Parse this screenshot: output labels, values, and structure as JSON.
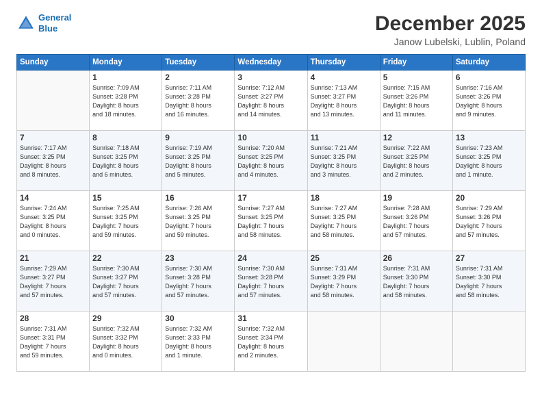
{
  "header": {
    "logo_line1": "General",
    "logo_line2": "Blue",
    "month": "December 2025",
    "location": "Janow Lubelski, Lublin, Poland"
  },
  "weekdays": [
    "Sunday",
    "Monday",
    "Tuesday",
    "Wednesday",
    "Thursday",
    "Friday",
    "Saturday"
  ],
  "weeks": [
    [
      {
        "day": "",
        "info": ""
      },
      {
        "day": "1",
        "info": "Sunrise: 7:09 AM\nSunset: 3:28 PM\nDaylight: 8 hours\nand 18 minutes."
      },
      {
        "day": "2",
        "info": "Sunrise: 7:11 AM\nSunset: 3:28 PM\nDaylight: 8 hours\nand 16 minutes."
      },
      {
        "day": "3",
        "info": "Sunrise: 7:12 AM\nSunset: 3:27 PM\nDaylight: 8 hours\nand 14 minutes."
      },
      {
        "day": "4",
        "info": "Sunrise: 7:13 AM\nSunset: 3:27 PM\nDaylight: 8 hours\nand 13 minutes."
      },
      {
        "day": "5",
        "info": "Sunrise: 7:15 AM\nSunset: 3:26 PM\nDaylight: 8 hours\nand 11 minutes."
      },
      {
        "day": "6",
        "info": "Sunrise: 7:16 AM\nSunset: 3:26 PM\nDaylight: 8 hours\nand 9 minutes."
      }
    ],
    [
      {
        "day": "7",
        "info": "Sunrise: 7:17 AM\nSunset: 3:25 PM\nDaylight: 8 hours\nand 8 minutes."
      },
      {
        "day": "8",
        "info": "Sunrise: 7:18 AM\nSunset: 3:25 PM\nDaylight: 8 hours\nand 6 minutes."
      },
      {
        "day": "9",
        "info": "Sunrise: 7:19 AM\nSunset: 3:25 PM\nDaylight: 8 hours\nand 5 minutes."
      },
      {
        "day": "10",
        "info": "Sunrise: 7:20 AM\nSunset: 3:25 PM\nDaylight: 8 hours\nand 4 minutes."
      },
      {
        "day": "11",
        "info": "Sunrise: 7:21 AM\nSunset: 3:25 PM\nDaylight: 8 hours\nand 3 minutes."
      },
      {
        "day": "12",
        "info": "Sunrise: 7:22 AM\nSunset: 3:25 PM\nDaylight: 8 hours\nand 2 minutes."
      },
      {
        "day": "13",
        "info": "Sunrise: 7:23 AM\nSunset: 3:25 PM\nDaylight: 8 hours\nand 1 minute."
      }
    ],
    [
      {
        "day": "14",
        "info": "Sunrise: 7:24 AM\nSunset: 3:25 PM\nDaylight: 8 hours\nand 0 minutes."
      },
      {
        "day": "15",
        "info": "Sunrise: 7:25 AM\nSunset: 3:25 PM\nDaylight: 7 hours\nand 59 minutes."
      },
      {
        "day": "16",
        "info": "Sunrise: 7:26 AM\nSunset: 3:25 PM\nDaylight: 7 hours\nand 59 minutes."
      },
      {
        "day": "17",
        "info": "Sunrise: 7:27 AM\nSunset: 3:25 PM\nDaylight: 7 hours\nand 58 minutes."
      },
      {
        "day": "18",
        "info": "Sunrise: 7:27 AM\nSunset: 3:25 PM\nDaylight: 7 hours\nand 58 minutes."
      },
      {
        "day": "19",
        "info": "Sunrise: 7:28 AM\nSunset: 3:26 PM\nDaylight: 7 hours\nand 57 minutes."
      },
      {
        "day": "20",
        "info": "Sunrise: 7:29 AM\nSunset: 3:26 PM\nDaylight: 7 hours\nand 57 minutes."
      }
    ],
    [
      {
        "day": "21",
        "info": "Sunrise: 7:29 AM\nSunset: 3:27 PM\nDaylight: 7 hours\nand 57 minutes."
      },
      {
        "day": "22",
        "info": "Sunrise: 7:30 AM\nSunset: 3:27 PM\nDaylight: 7 hours\nand 57 minutes."
      },
      {
        "day": "23",
        "info": "Sunrise: 7:30 AM\nSunset: 3:28 PM\nDaylight: 7 hours\nand 57 minutes."
      },
      {
        "day": "24",
        "info": "Sunrise: 7:30 AM\nSunset: 3:28 PM\nDaylight: 7 hours\nand 57 minutes."
      },
      {
        "day": "25",
        "info": "Sunrise: 7:31 AM\nSunset: 3:29 PM\nDaylight: 7 hours\nand 58 minutes."
      },
      {
        "day": "26",
        "info": "Sunrise: 7:31 AM\nSunset: 3:30 PM\nDaylight: 7 hours\nand 58 minutes."
      },
      {
        "day": "27",
        "info": "Sunrise: 7:31 AM\nSunset: 3:30 PM\nDaylight: 7 hours\nand 58 minutes."
      }
    ],
    [
      {
        "day": "28",
        "info": "Sunrise: 7:31 AM\nSunset: 3:31 PM\nDaylight: 7 hours\nand 59 minutes."
      },
      {
        "day": "29",
        "info": "Sunrise: 7:32 AM\nSunset: 3:32 PM\nDaylight: 8 hours\nand 0 minutes."
      },
      {
        "day": "30",
        "info": "Sunrise: 7:32 AM\nSunset: 3:33 PM\nDaylight: 8 hours\nand 1 minute."
      },
      {
        "day": "31",
        "info": "Sunrise: 7:32 AM\nSunset: 3:34 PM\nDaylight: 8 hours\nand 2 minutes."
      },
      {
        "day": "",
        "info": ""
      },
      {
        "day": "",
        "info": ""
      },
      {
        "day": "",
        "info": ""
      }
    ]
  ]
}
